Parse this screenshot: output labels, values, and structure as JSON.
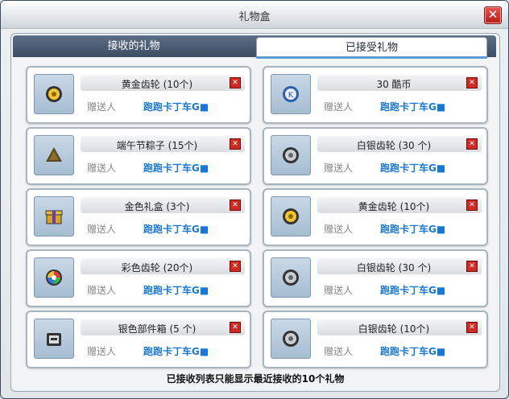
{
  "window": {
    "title": "礼物盒",
    "close_icon": "close-icon"
  },
  "tabs": [
    {
      "label": "接收的礼物",
      "active": false
    },
    {
      "label": "已接受礼物",
      "active": true
    }
  ],
  "gifts": [
    {
      "name": "黄金齿轮 (10个)",
      "sender_label": "赠送人",
      "sender": "跑跑卡丁车G■",
      "icon": "gold-gear-icon"
    },
    {
      "name": "30  酷币",
      "sender_label": "赠送人",
      "sender": "跑跑卡丁车G■",
      "icon": "coin-icon"
    },
    {
      "name": "端午节粽子 (15个)",
      "sender_label": "赠送人",
      "sender": "跑跑卡丁车G■",
      "icon": "rice-dumpling-icon"
    },
    {
      "name": "白银齿轮 (30 个)",
      "sender_label": "赠送人",
      "sender": "跑跑卡丁车G■",
      "icon": "silver-gear-icon"
    },
    {
      "name": "金色礼盒 (3个)",
      "sender_label": "赠送人",
      "sender": "跑跑卡丁车G■",
      "icon": "gift-box-icon"
    },
    {
      "name": "黄金齿轮 (10个)",
      "sender_label": "赠送人",
      "sender": "跑跑卡丁车G■",
      "icon": "gold-gear-icon"
    },
    {
      "name": "彩色齿轮 (20个)",
      "sender_label": "赠送人",
      "sender": "跑跑卡丁车G■",
      "icon": "rainbow-gear-icon"
    },
    {
      "name": "白银齿轮 (30 个)",
      "sender_label": "赠送人",
      "sender": "跑跑卡丁车G■",
      "icon": "silver-gear-icon"
    },
    {
      "name": "银色部件箱 (5 个)",
      "sender_label": "赠送人",
      "sender": "跑跑卡丁车G■",
      "icon": "parts-box-icon"
    },
    {
      "name": "白银齿轮 (10个)",
      "sender_label": "赠送人",
      "sender": "跑跑卡丁车G■",
      "icon": "silver-gear-icon"
    }
  ],
  "footer_note": "已接收列表只能显示最近接收的10个礼物",
  "colors": {
    "sender": "#1a78d4",
    "tab_bar": "#4a5c73",
    "delete": "#d12a22"
  }
}
